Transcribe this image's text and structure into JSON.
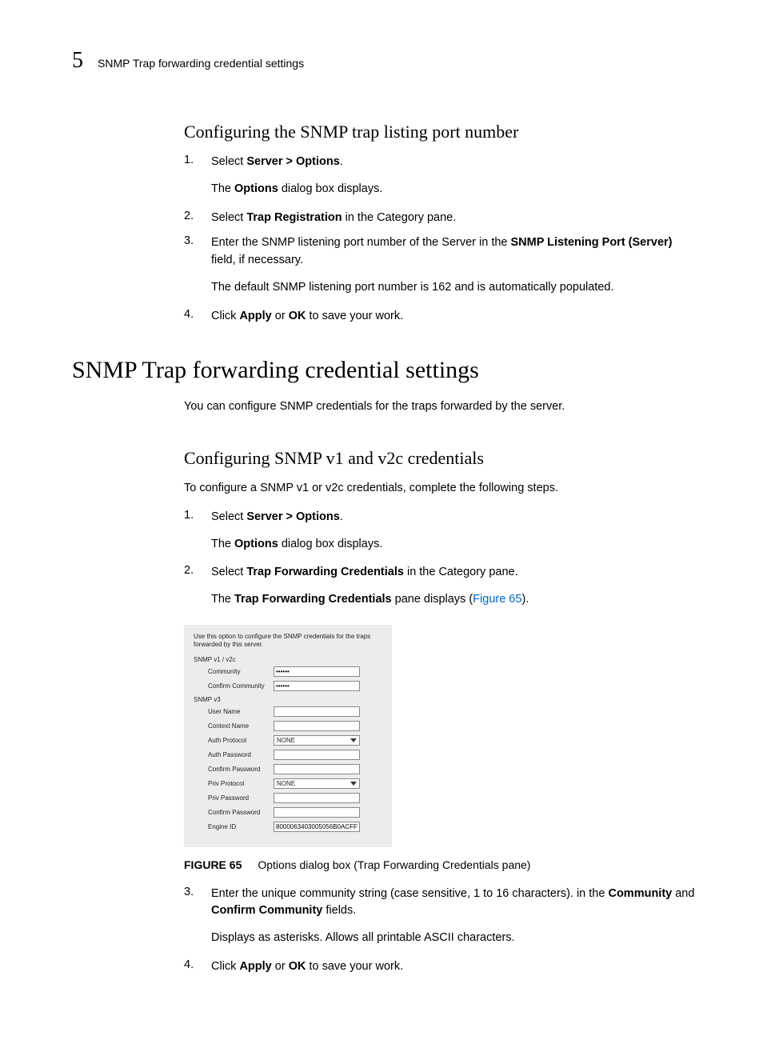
{
  "header": {
    "chapter": "5",
    "running_head": "SNMP Trap forwarding credential settings"
  },
  "section1": {
    "title": "Configuring the SNMP trap listing port number",
    "step1_a": "Select ",
    "step1_b": "Server > Options",
    "step1_c": ".",
    "step1_sub_a": "The ",
    "step1_sub_b": "Options",
    "step1_sub_c": " dialog box displays.",
    "step2_a": "Select ",
    "step2_b": "Trap Registration",
    "step2_c": " in the Category pane.",
    "step3_a": "Enter the SNMP listening port number of the Server in the ",
    "step3_b": "SNMP Listening Port (Server)",
    "step3_c": " field, if necessary.",
    "step3_sub": "The default SNMP listening port number is 162 and is automatically populated.",
    "step4_a": "Click ",
    "step4_b": "Apply",
    "step4_c": " or ",
    "step4_d": "OK",
    "step4_e": " to save your work."
  },
  "heading1": "SNMP Trap forwarding credential settings",
  "intro1": "You can configure SNMP credentials for the traps forwarded by the server.",
  "section2": {
    "title": "Configuring SNMP v1 and v2c credentials",
    "intro": "To configure a SNMP v1 or v2c credentials, complete the following steps.",
    "step1_a": "Select ",
    "step1_b": "Server > Options",
    "step1_c": ".",
    "step1_sub_a": "The ",
    "step1_sub_b": "Options",
    "step1_sub_c": " dialog box displays.",
    "step2_a": "Select ",
    "step2_b": "Trap Forwarding Credentials",
    "step2_c": " in the Category pane.",
    "step2_sub_a": "The ",
    "step2_sub_b": "Trap Forwarding Credentials",
    "step2_sub_c": " pane displays (",
    "step2_sub_link": "Figure 65",
    "step2_sub_d": ").",
    "step3_a": "Enter the unique community string (case sensitive, 1 to 16 characters). in the ",
    "step3_b": "Community",
    "step3_c": " and ",
    "step3_d": "Confirm Community",
    "step3_e": " fields.",
    "step3_sub": "Displays as asterisks. Allows all printable ASCII characters.",
    "step4_a": "Click ",
    "step4_b": "Apply",
    "step4_c": " or ",
    "step4_d": "OK",
    "step4_e": " to save your work."
  },
  "dialog": {
    "intro": "Use this option to configure the SNMP credentials for the traps forwarded by this server.",
    "sec1": "SNMP v1 / v2c",
    "community_label": "Community",
    "community_value": "••••••",
    "confirm_community_label": "Confirm Community",
    "confirm_community_value": "••••••",
    "sec2": "SNMP v3",
    "user_name_label": "User Name",
    "context_name_label": "Context Name",
    "auth_protocol_label": "Auth Protocol",
    "auth_protocol_value": "NONE",
    "auth_password_label": "Auth Password",
    "confirm_password_label": "Confirm Password",
    "priv_protocol_label": "Priv Protocol",
    "priv_protocol_value": "NONE",
    "priv_password_label": "Priv Password",
    "confirm_password2_label": "Confirm Password",
    "engine_id_label": "Engine ID",
    "engine_id_value": "8000063403005056B0ACFF"
  },
  "figure": {
    "label": "FIGURE 65",
    "caption": "Options dialog box (Trap Forwarding Credentials pane)"
  }
}
